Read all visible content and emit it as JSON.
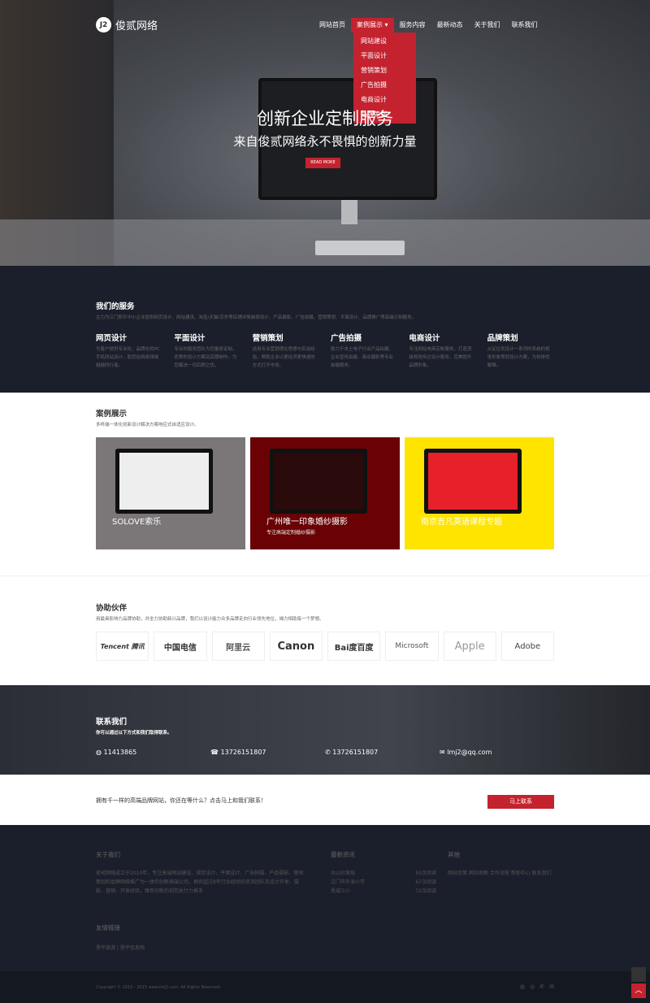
{
  "logo": {
    "text": "俊贰网络",
    "mark": "J2"
  },
  "nav": [
    "网站首页",
    "案例展示",
    "服务内容",
    "最新动态",
    "关于我们",
    "联系我们"
  ],
  "dropdown": [
    "网站建设",
    "平面设计",
    "营销策划",
    "广告拍摄",
    "电商设计",
    "品牌策划"
  ],
  "hero": {
    "title": "创新企业定制服务",
    "subtitle": "来自俊贰网络永不畏惧的创新力量",
    "button": "READ MORE"
  },
  "services": {
    "title": "我们的服务",
    "subtitle": "主力为江门即平中小企业提供网页设计、网站建设、淘宝/天猫/京东等店铺详情装修设计、产品摄影、广告拍摄、营销策划、平面设计、品牌推广等高端订制服务。",
    "items": [
      {
        "title": "网页设计",
        "desc": "为客户提供专业化、品牌化的PC手机网站设计，助您在网络领域越越同行者。"
      },
      {
        "title": "平面设计",
        "desc": "专业的服务团队为您量身定制，优秀的设计方案及后期制作，为您解决一切后顾之忧。"
      },
      {
        "title": "营销策划",
        "desc": "运用专业营销理论思想与实战经验，帮助企业以更经济更快速的方式打开市场。"
      },
      {
        "title": "广告拍摄",
        "desc": "致力于本土电子行业产品拍摄、企业宣传拍摄、商业摄影等专业拍摄服务。"
      },
      {
        "title": "电商设计",
        "desc": "专注网站电商定制服务，打造顶级视觉传达设计服务，完美提升品牌形象。"
      },
      {
        "title": "品牌策划",
        "desc": "从定位到设计一系列的系统的视觉形象策划设计方案，为你排忧解难。"
      }
    ]
  },
  "cases": {
    "title": "案例展示",
    "subtitle": "多终端一体化创新设计解决方案响应式自适应设计。",
    "items": [
      {
        "title": "SOLOVE索乐",
        "sub": "",
        "color": "#7b7678"
      },
      {
        "title": "广州唯一印象婚纱摄影",
        "sub": "专注高端定制婚纱摄影",
        "color": "#6a0205"
      },
      {
        "title": "南京吉凡英语课程专题",
        "sub": "",
        "color": "#ffe400"
      }
    ]
  },
  "partners": {
    "title": "协助伙伴",
    "subtitle": "用最具影响力品牌协助，并全力协助新兴品牌，我们以设计能力众多品牌走向行业领先地位，竭力相助每一个梦想。",
    "items": [
      "Tencent 腾讯",
      "中国电信",
      "阿里云",
      "Canon",
      "Bai度百度",
      "Microsoft",
      "Apple",
      "Adobe"
    ]
  },
  "contact": {
    "title": "联系我们",
    "subtitle": "你可以通过以下方式和我们取得联系。",
    "items": [
      "11413865",
      "13726151807",
      "13726151807",
      "lmj2@qq.com"
    ]
  },
  "cta": {
    "text": "拥有千一样的高端品牌网站，你还在等什么？点击马上和我们联系！",
    "button": "马上联系"
  },
  "footer": {
    "about_title": "关于我们",
    "about": "俊贰网络成立于2010年，专注高端网站建设、视觉设计、平面设计、广告拍摄、产品摄影、营销策划和品牌网络推广为一体的创新高端公司，拥有超过8年行业经验的资深团队及设计开发、摄影、营销、开发经验，臻萃创新的视觉执行力推手",
    "news_title": "最新资讯",
    "news": [
      {
        "t": "台山社保局",
        "n": "93次阅读"
      },
      {
        "t": "江门市外海小学",
        "n": "67次阅读"
      },
      {
        "t": "恩城三小",
        "n": "72次阅读"
      }
    ],
    "other_title": "其他",
    "other": "网站优策 网站地图 合作流程 帮助中心 联系我们",
    "links_title": "友情链接",
    "links": [
      "恩平旅游",
      "恩平信息网"
    ],
    "copyright": "Copyright © 2015 - 2015 www.lmj2.com. All Rights Reserved."
  },
  "accent": "#c4222f"
}
